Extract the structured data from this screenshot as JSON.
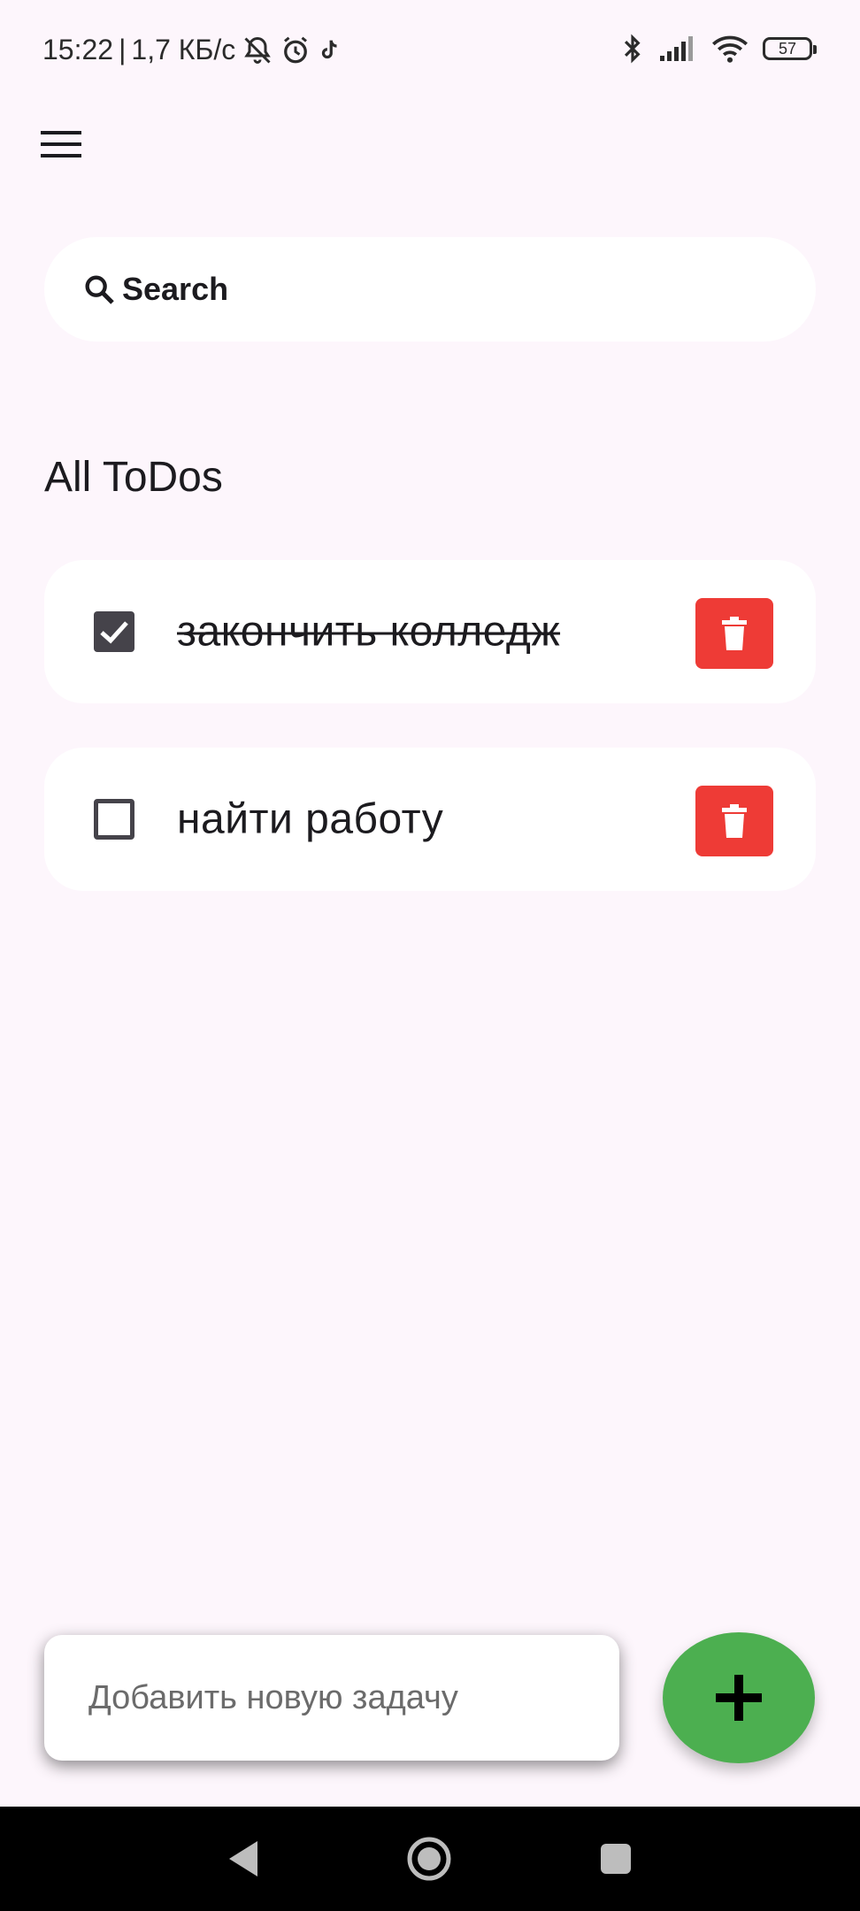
{
  "status_bar": {
    "time": "15:22",
    "separator": "|",
    "network_speed": "1,7 КБ/с",
    "battery_level": "57",
    "icons_left": [
      "mute-icon",
      "alarm-icon",
      "tiktok-icon"
    ],
    "icons_right": [
      "bluetooth-icon",
      "signal-icon",
      "wifi-icon",
      "battery-icon"
    ]
  },
  "header": {
    "menu_icon": "menu-icon"
  },
  "search": {
    "placeholder": "Search",
    "icon": "search-icon"
  },
  "main": {
    "title": "All ToDos",
    "todos": [
      {
        "text": "закончить колледж",
        "done": true
      },
      {
        "text": "найти работу",
        "done": false
      }
    ]
  },
  "footer": {
    "add_placeholder": "Добавить новую задачу",
    "add_button_icon": "plus-icon"
  },
  "colors": {
    "background": "#FDF6FC",
    "card": "#FFFFFF",
    "delete": "#EE3B36",
    "fab": "#4CAF50",
    "checkbox": "#45434A",
    "nav_bar": "#000000"
  },
  "nav": {
    "buttons": [
      "back-icon",
      "home-icon",
      "recent-apps-icon"
    ]
  }
}
